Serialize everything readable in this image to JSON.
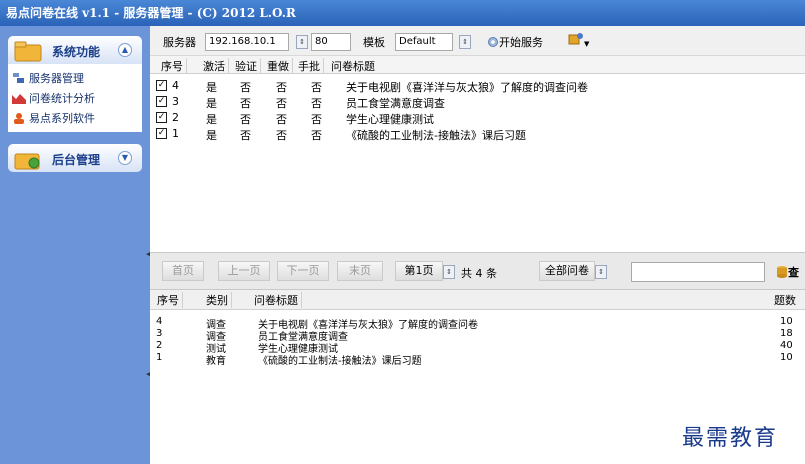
{
  "window": {
    "title": "易点问卷在线 v1.1 - 服务器管理 - (C) 2012 L.O.R"
  },
  "sidebar": {
    "sections": [
      {
        "label": "系统功能",
        "expanded": true
      },
      {
        "label": "后台管理",
        "expanded": false
      }
    ],
    "items": [
      {
        "label": "服务器管理",
        "icon": "server-icon"
      },
      {
        "label": "问卷统计分析",
        "icon": "chart-icon"
      },
      {
        "label": "易点系列软件",
        "icon": "user-icon"
      }
    ]
  },
  "toolbar": {
    "server_label": "服务器",
    "server_value": "192.168.10.1",
    "port_value": "80",
    "template_label": "模板",
    "template_value": "Default",
    "start_label": "开始服务"
  },
  "service_grid": {
    "columns": [
      "序号",
      "激活",
      "验证",
      "重做",
      "手批",
      "问卷标题"
    ],
    "rows": [
      {
        "checked": true,
        "id": "4",
        "active": "是",
        "verify": "否",
        "redo": "否",
        "manual": "否",
        "title": "关于电视剧《喜洋洋与灰太狼》了解度的调查问卷"
      },
      {
        "checked": true,
        "id": "3",
        "active": "是",
        "verify": "否",
        "redo": "否",
        "manual": "否",
        "title": "员工食堂满意度调查"
      },
      {
        "checked": true,
        "id": "2",
        "active": "是",
        "verify": "否",
        "redo": "否",
        "manual": "否",
        "title": "学生心理健康测试"
      },
      {
        "checked": true,
        "id": "1",
        "active": "是",
        "verify": "否",
        "redo": "否",
        "manual": "否",
        "title": "《硫酸的工业制法-接触法》课后习题"
      }
    ]
  },
  "pager": {
    "first": "首页",
    "prev": "上一页",
    "next": "下一页",
    "last": "末页",
    "current_page": "第1页",
    "total": "共 4 条",
    "filter": "全部问卷",
    "search_placeholder": "",
    "search_button": "查"
  },
  "survey_grid": {
    "columns": [
      "序号",
      "类别",
      "问卷标题",
      "题数"
    ],
    "rows": [
      {
        "id": "4",
        "category": "调查",
        "title": "关于电视剧《喜洋洋与灰太狼》了解度的调查问卷",
        "count": "10"
      },
      {
        "id": "3",
        "category": "调查",
        "title": "员工食堂满意度调查",
        "count": "18"
      },
      {
        "id": "2",
        "category": "测试",
        "title": "学生心理健康测试",
        "count": "40"
      },
      {
        "id": "1",
        "category": "教育",
        "title": "《硫酸的工业制法-接触法》课后习题",
        "count": "10"
      }
    ]
  },
  "watermark": "最需教育",
  "colors": {
    "titlebar": "#2a63b8",
    "sidebar": "#6b95d8",
    "watermark": "#1a3a8c"
  }
}
